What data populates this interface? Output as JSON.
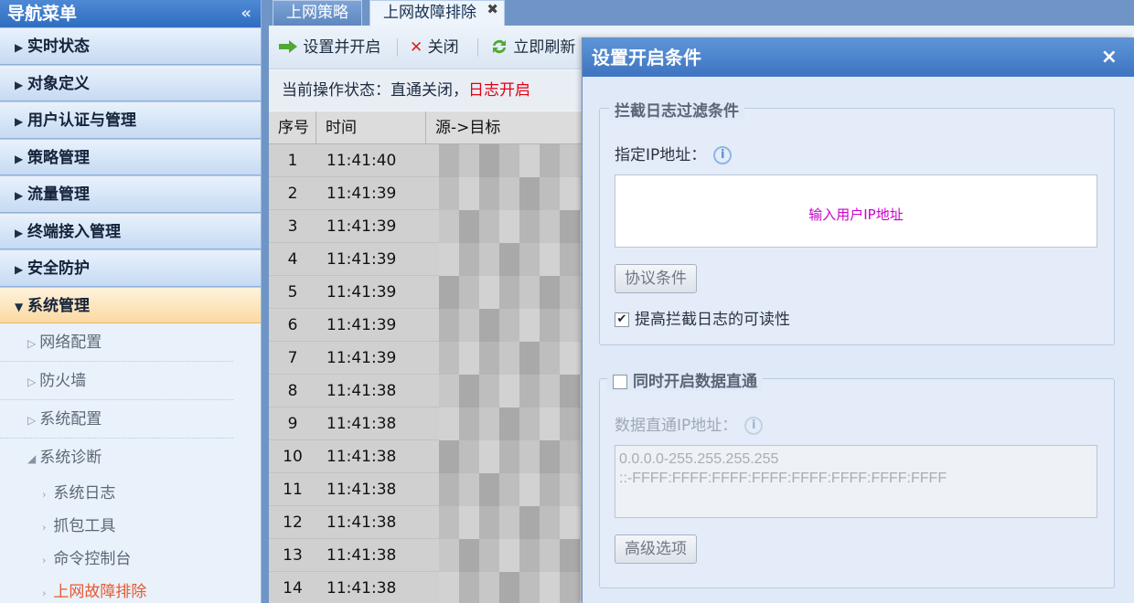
{
  "sidebar": {
    "title": "导航菜单",
    "collapse_glyph": "«",
    "categories": [
      {
        "label": "实时状态"
      },
      {
        "label": "对象定义"
      },
      {
        "label": "用户认证与管理"
      },
      {
        "label": "策略管理"
      },
      {
        "label": "流量管理"
      },
      {
        "label": "终端接入管理"
      },
      {
        "label": "安全防护"
      },
      {
        "label": "系统管理"
      }
    ],
    "sub_items": [
      {
        "label": "网络配置"
      },
      {
        "label": "防火墙"
      },
      {
        "label": "系统配置"
      },
      {
        "label": "系统诊断"
      }
    ],
    "leaf_items": [
      {
        "label": "系统日志"
      },
      {
        "label": "抓包工具"
      },
      {
        "label": "命令控制台"
      },
      {
        "label": "上网故障排除"
      }
    ]
  },
  "tabs": [
    {
      "label": "上网策略"
    },
    {
      "label": "上网故障排除"
    }
  ],
  "toolbar": {
    "set_enable": "设置并开启",
    "close": "关闭",
    "refresh": "立即刷新"
  },
  "status": {
    "prefix": "当前操作状态：直通关闭，",
    "log_state": "日志开启"
  },
  "grid": {
    "columns": [
      "序号",
      "时间",
      "源->目标"
    ],
    "rows": [
      {
        "idx": "1",
        "time": "11:41:40",
        "st": ""
      },
      {
        "idx": "2",
        "time": "11:41:39",
        "st": ""
      },
      {
        "idx": "3",
        "time": "11:41:39",
        "st": ""
      },
      {
        "idx": "4",
        "time": "11:41:39",
        "st": ""
      },
      {
        "idx": "5",
        "time": "11:41:39",
        "st": ""
      },
      {
        "idx": "6",
        "time": "11:41:39",
        "st": ""
      },
      {
        "idx": "7",
        "time": "11:41:39",
        "st": ""
      },
      {
        "idx": "8",
        "time": "11:41:38",
        "st": ""
      },
      {
        "idx": "9",
        "time": "11:41:38",
        "st": ""
      },
      {
        "idx": "10",
        "time": "11:41:38",
        "st": ""
      },
      {
        "idx": "11",
        "time": "11:41:38",
        "st": ""
      },
      {
        "idx": "12",
        "time": "11:41:38",
        "st": ""
      },
      {
        "idx": "13",
        "time": "11:41:38",
        "st": ""
      },
      {
        "idx": "14",
        "time": "11:41:38",
        "st": ""
      }
    ]
  },
  "dialog": {
    "title": "设置开启条件",
    "close_glyph": "×",
    "filter": {
      "legend": "拦截日志过滤条件",
      "ip_label": "指定IP地址：",
      "ip_placeholder": "输入用户IP地址",
      "protocol_button": "协议条件",
      "readability_label": "提高拦截日志的可读性",
      "readability_checked": true
    },
    "passthrough": {
      "legend": "同时开启数据直通",
      "enabled": false,
      "ip_label": "数据直通IP地址：",
      "ip_line1": "0.0.0.0-255.255.255.255",
      "ip_line2": "::-FFFF:FFFF:FFFF:FFFF:FFFF:FFFF:FFFF:FFFF",
      "advanced_button": "高级选项"
    }
  },
  "colors": {
    "accent_blue": "#3e74c0",
    "log_on_red": "#e60012",
    "placeholder_magenta": "#cc00cc",
    "active_leaf": "#e9582f"
  }
}
